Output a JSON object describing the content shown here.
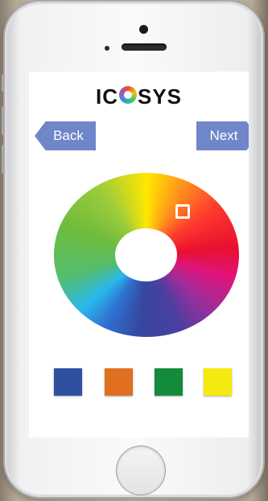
{
  "app": {
    "logo_text_before": "IC",
    "logo_text_after": "SYS"
  },
  "nav": {
    "back_label": "Back",
    "next_label": "Next",
    "button_color": "#6f86c9"
  },
  "color_wheel": {
    "selector_color": "#ffffff"
  },
  "swatches": [
    {
      "name": "blue",
      "color": "#2f4fa0"
    },
    {
      "name": "orange",
      "color": "#e0701f"
    },
    {
      "name": "green",
      "color": "#148a3c"
    },
    {
      "name": "yellow",
      "color": "#f4ea10"
    }
  ]
}
